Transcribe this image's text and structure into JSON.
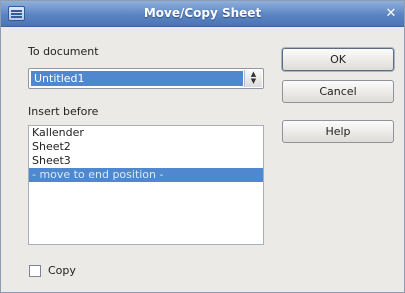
{
  "window": {
    "title": "Move/Copy Sheet",
    "close_glyph": "✕"
  },
  "to_document": {
    "label": "To document",
    "selected": "Untitled1"
  },
  "insert_before": {
    "label": "Insert before",
    "items": [
      "Kallender",
      "Sheet2",
      "Sheet3",
      "- move to end position -"
    ],
    "selected_index": 3
  },
  "copy": {
    "label": "Copy",
    "checked": false
  },
  "buttons": {
    "ok": "OK",
    "cancel": "Cancel",
    "help": "Help"
  },
  "icons": {
    "app": "sheet-icon",
    "close": "close-icon",
    "spin": "spin-arrows-icon"
  }
}
